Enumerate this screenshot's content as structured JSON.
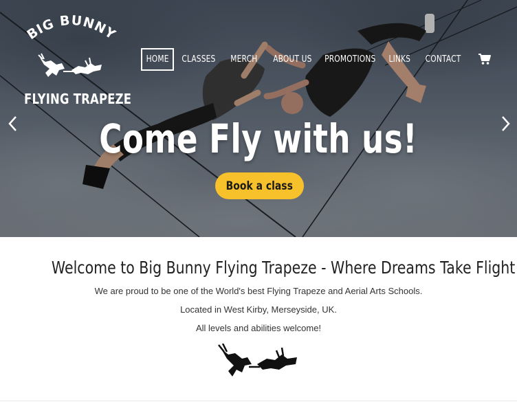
{
  "logo": {
    "top_text": "BIG BUNNY",
    "bottom_text": "FLYING TRAPEZE",
    "icon": "bunnies-trapeze-icon"
  },
  "nav": {
    "items": [
      {
        "label": "HOME",
        "active": true
      },
      {
        "label": "CLASSES",
        "active": false
      },
      {
        "label": "MERCH",
        "active": false
      },
      {
        "label": "ABOUT US",
        "active": false
      },
      {
        "label": "PROMOTIONS",
        "active": false
      },
      {
        "label": "LINKS",
        "active": false
      },
      {
        "label": "CONTACT",
        "active": false
      }
    ],
    "cart_icon": "cart-icon"
  },
  "hero": {
    "headline": "Come Fly with us!",
    "button_label": "Book a class",
    "button_color": "#f7c12c",
    "prev_icon": "chevron-left-icon",
    "next_icon": "chevron-right-icon"
  },
  "content": {
    "heading": "Welcome to Big Bunny Flying Trapeze - Where Dreams Take Flight!",
    "line1": "We are proud to be one of the World's best Flying Trapeze and Aerial Arts Schools.",
    "line2": "Located in West Kirby, Merseyside, UK.",
    "line3": "All levels and abilities welcome!",
    "divider_icon": "bunnies-trapeze-icon"
  }
}
